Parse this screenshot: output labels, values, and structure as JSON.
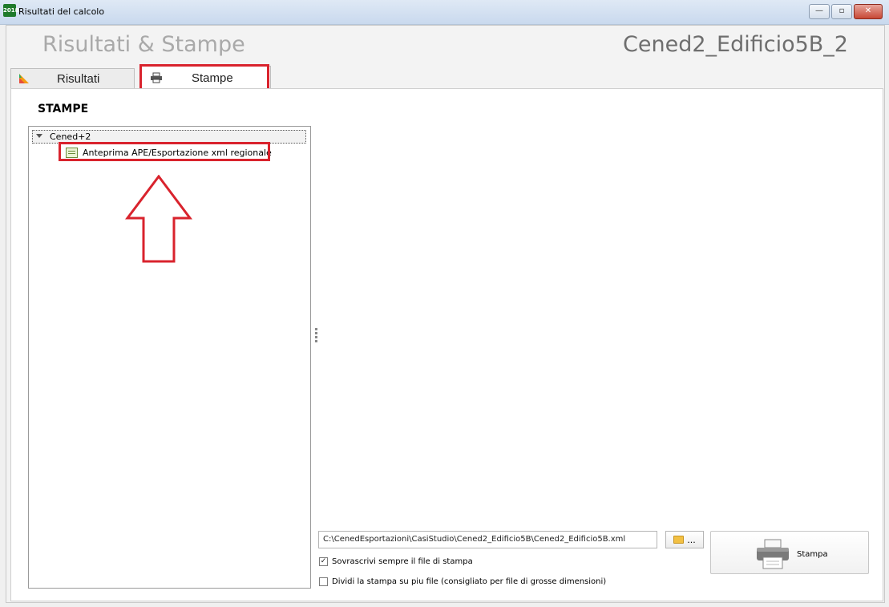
{
  "window": {
    "title": "Risultati del calcolo",
    "app_icon_text": "2018",
    "min": "—",
    "max": "▫",
    "close": "✕"
  },
  "header": {
    "title": "Risultati & Stampe",
    "project": "Cened2_Edificio5B_2"
  },
  "tabs": [
    {
      "label": "Risultati",
      "icon": "chart-icon",
      "active": false
    },
    {
      "label": "Stampe",
      "icon": "printer-icon",
      "active": true
    }
  ],
  "section_title": "STAMPE",
  "tree": {
    "root": "Cened+2",
    "children": [
      {
        "label": "Anteprima APE/Esportazione xml regionale",
        "icon": "document-icon"
      }
    ]
  },
  "output": {
    "path": "C:\\CenedEsportazioni\\CasiStudio\\Cened2_Edificio5B\\Cened2_Edificio5B.xml",
    "browse_label": "...",
    "overwrite_label": "Sovrascrivi sempre il file di stampa",
    "overwrite_checked": true,
    "split_label": "Dividi la stampa su piu file (consigliato per file di grosse dimensioni)",
    "split_checked": false,
    "print_button": "Stampa"
  },
  "colors": {
    "highlight": "#d9232d",
    "header_title": "#a9a9a9",
    "header_project": "#6e6e6e"
  }
}
